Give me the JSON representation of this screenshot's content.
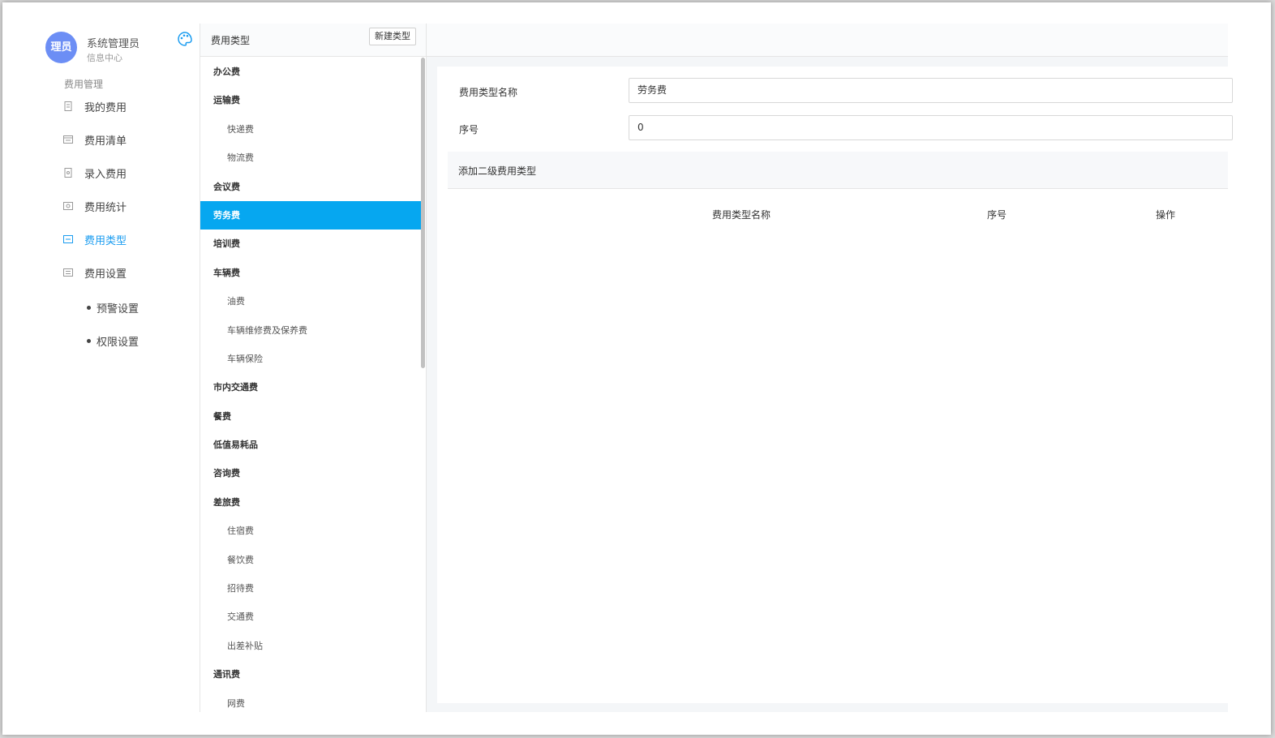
{
  "user": {
    "avatar_text": "理员",
    "name": "系统管理员",
    "department": "信息中心"
  },
  "sidebar": {
    "section_title": "费用管理",
    "items": [
      {
        "label": "我的费用",
        "icon": "file-icon"
      },
      {
        "label": "费用清单",
        "icon": "list-icon"
      },
      {
        "label": "录入费用",
        "icon": "edit-icon"
      },
      {
        "label": "费用统计",
        "icon": "chart-icon"
      },
      {
        "label": "费用类型",
        "icon": "type-icon",
        "active": true
      },
      {
        "label": "费用设置",
        "icon": "settings-icon"
      }
    ],
    "sub_items": [
      {
        "label": "预警设置"
      },
      {
        "label": "权限设置"
      }
    ]
  },
  "type_panel": {
    "title": "费用类型",
    "new_button_label": "新建类型",
    "items": [
      {
        "label": "办公费",
        "level": 1
      },
      {
        "label": "运输费",
        "level": 1
      },
      {
        "label": "快递费",
        "level": 2
      },
      {
        "label": "物流费",
        "level": 2
      },
      {
        "label": "会议费",
        "level": 1
      },
      {
        "label": "劳务费",
        "level": 1,
        "selected": true
      },
      {
        "label": "培训费",
        "level": 1
      },
      {
        "label": "车辆费",
        "level": 1
      },
      {
        "label": "油费",
        "level": 2
      },
      {
        "label": "车辆维修费及保养费",
        "level": 2
      },
      {
        "label": "车辆保险",
        "level": 2
      },
      {
        "label": "市内交通费",
        "level": 1
      },
      {
        "label": "餐费",
        "level": 1
      },
      {
        "label": "低值易耗品",
        "level": 1
      },
      {
        "label": "咨询费",
        "level": 1
      },
      {
        "label": "差旅费",
        "level": 1
      },
      {
        "label": "住宿费",
        "level": 2
      },
      {
        "label": "餐饮费",
        "level": 2
      },
      {
        "label": "招待费",
        "level": 2
      },
      {
        "label": "交通费",
        "level": 2
      },
      {
        "label": "出差补贴",
        "level": 2
      },
      {
        "label": "通讯费",
        "level": 1
      },
      {
        "label": "网费",
        "level": 2
      }
    ]
  },
  "detail": {
    "name_label": "费用类型名称",
    "name_value": "劳务费",
    "order_label": "序号",
    "order_value": "0",
    "subtype_header": "添加二级费用类型",
    "columns": [
      "费用类型名称",
      "序号",
      "操作"
    ]
  },
  "colors": {
    "accent": "#1a9cf0",
    "selected_bg": "#06a7f0",
    "avatar_bg": "#6c8ef5"
  }
}
